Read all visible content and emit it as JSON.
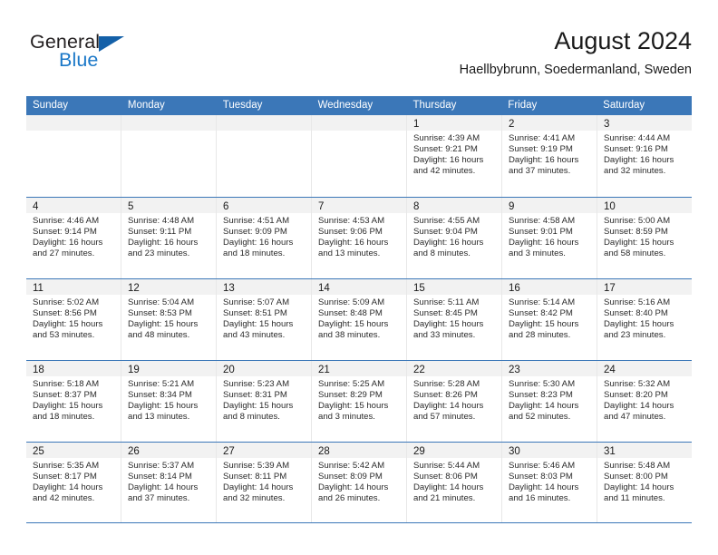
{
  "brand": {
    "name_part1": "General",
    "name_part2": "Blue",
    "triangle_color": "#1460a8",
    "blue_color": "#1b78c8"
  },
  "header": {
    "title": "August 2024",
    "subtitle": "Haellbybrunn, Soedermanland, Sweden"
  },
  "theme": {
    "header_blue": "#3b77b8",
    "date_band_gray": "#f2f2f2",
    "cell_border": "#e8e8e8"
  },
  "weekdays": [
    "Sunday",
    "Monday",
    "Tuesday",
    "Wednesday",
    "Thursday",
    "Friday",
    "Saturday"
  ],
  "weeks": [
    [
      {
        "date": "",
        "empty": true
      },
      {
        "date": "",
        "empty": true
      },
      {
        "date": "",
        "empty": true
      },
      {
        "date": "",
        "empty": true
      },
      {
        "date": "1",
        "sunrise": "Sunrise: 4:39 AM",
        "sunset": "Sunset: 9:21 PM",
        "daylight_line1": "Daylight: 16 hours",
        "daylight_line2": "and 42 minutes."
      },
      {
        "date": "2",
        "sunrise": "Sunrise: 4:41 AM",
        "sunset": "Sunset: 9:19 PM",
        "daylight_line1": "Daylight: 16 hours",
        "daylight_line2": "and 37 minutes."
      },
      {
        "date": "3",
        "sunrise": "Sunrise: 4:44 AM",
        "sunset": "Sunset: 9:16 PM",
        "daylight_line1": "Daylight: 16 hours",
        "daylight_line2": "and 32 minutes."
      }
    ],
    [
      {
        "date": "4",
        "sunrise": "Sunrise: 4:46 AM",
        "sunset": "Sunset: 9:14 PM",
        "daylight_line1": "Daylight: 16 hours",
        "daylight_line2": "and 27 minutes."
      },
      {
        "date": "5",
        "sunrise": "Sunrise: 4:48 AM",
        "sunset": "Sunset: 9:11 PM",
        "daylight_line1": "Daylight: 16 hours",
        "daylight_line2": "and 23 minutes."
      },
      {
        "date": "6",
        "sunrise": "Sunrise: 4:51 AM",
        "sunset": "Sunset: 9:09 PM",
        "daylight_line1": "Daylight: 16 hours",
        "daylight_line2": "and 18 minutes."
      },
      {
        "date": "7",
        "sunrise": "Sunrise: 4:53 AM",
        "sunset": "Sunset: 9:06 PM",
        "daylight_line1": "Daylight: 16 hours",
        "daylight_line2": "and 13 minutes."
      },
      {
        "date": "8",
        "sunrise": "Sunrise: 4:55 AM",
        "sunset": "Sunset: 9:04 PM",
        "daylight_line1": "Daylight: 16 hours",
        "daylight_line2": "and 8 minutes."
      },
      {
        "date": "9",
        "sunrise": "Sunrise: 4:58 AM",
        "sunset": "Sunset: 9:01 PM",
        "daylight_line1": "Daylight: 16 hours",
        "daylight_line2": "and 3 minutes."
      },
      {
        "date": "10",
        "sunrise": "Sunrise: 5:00 AM",
        "sunset": "Sunset: 8:59 PM",
        "daylight_line1": "Daylight: 15 hours",
        "daylight_line2": "and 58 minutes."
      }
    ],
    [
      {
        "date": "11",
        "sunrise": "Sunrise: 5:02 AM",
        "sunset": "Sunset: 8:56 PM",
        "daylight_line1": "Daylight: 15 hours",
        "daylight_line2": "and 53 minutes."
      },
      {
        "date": "12",
        "sunrise": "Sunrise: 5:04 AM",
        "sunset": "Sunset: 8:53 PM",
        "daylight_line1": "Daylight: 15 hours",
        "daylight_line2": "and 48 minutes."
      },
      {
        "date": "13",
        "sunrise": "Sunrise: 5:07 AM",
        "sunset": "Sunset: 8:51 PM",
        "daylight_line1": "Daylight: 15 hours",
        "daylight_line2": "and 43 minutes."
      },
      {
        "date": "14",
        "sunrise": "Sunrise: 5:09 AM",
        "sunset": "Sunset: 8:48 PM",
        "daylight_line1": "Daylight: 15 hours",
        "daylight_line2": "and 38 minutes."
      },
      {
        "date": "15",
        "sunrise": "Sunrise: 5:11 AM",
        "sunset": "Sunset: 8:45 PM",
        "daylight_line1": "Daylight: 15 hours",
        "daylight_line2": "and 33 minutes."
      },
      {
        "date": "16",
        "sunrise": "Sunrise: 5:14 AM",
        "sunset": "Sunset: 8:42 PM",
        "daylight_line1": "Daylight: 15 hours",
        "daylight_line2": "and 28 minutes."
      },
      {
        "date": "17",
        "sunrise": "Sunrise: 5:16 AM",
        "sunset": "Sunset: 8:40 PM",
        "daylight_line1": "Daylight: 15 hours",
        "daylight_line2": "and 23 minutes."
      }
    ],
    [
      {
        "date": "18",
        "sunrise": "Sunrise: 5:18 AM",
        "sunset": "Sunset: 8:37 PM",
        "daylight_line1": "Daylight: 15 hours",
        "daylight_line2": "and 18 minutes."
      },
      {
        "date": "19",
        "sunrise": "Sunrise: 5:21 AM",
        "sunset": "Sunset: 8:34 PM",
        "daylight_line1": "Daylight: 15 hours",
        "daylight_line2": "and 13 minutes."
      },
      {
        "date": "20",
        "sunrise": "Sunrise: 5:23 AM",
        "sunset": "Sunset: 8:31 PM",
        "daylight_line1": "Daylight: 15 hours",
        "daylight_line2": "and 8 minutes."
      },
      {
        "date": "21",
        "sunrise": "Sunrise: 5:25 AM",
        "sunset": "Sunset: 8:29 PM",
        "daylight_line1": "Daylight: 15 hours",
        "daylight_line2": "and 3 minutes."
      },
      {
        "date": "22",
        "sunrise": "Sunrise: 5:28 AM",
        "sunset": "Sunset: 8:26 PM",
        "daylight_line1": "Daylight: 14 hours",
        "daylight_line2": "and 57 minutes."
      },
      {
        "date": "23",
        "sunrise": "Sunrise: 5:30 AM",
        "sunset": "Sunset: 8:23 PM",
        "daylight_line1": "Daylight: 14 hours",
        "daylight_line2": "and 52 minutes."
      },
      {
        "date": "24",
        "sunrise": "Sunrise: 5:32 AM",
        "sunset": "Sunset: 8:20 PM",
        "daylight_line1": "Daylight: 14 hours",
        "daylight_line2": "and 47 minutes."
      }
    ],
    [
      {
        "date": "25",
        "sunrise": "Sunrise: 5:35 AM",
        "sunset": "Sunset: 8:17 PM",
        "daylight_line1": "Daylight: 14 hours",
        "daylight_line2": "and 42 minutes."
      },
      {
        "date": "26",
        "sunrise": "Sunrise: 5:37 AM",
        "sunset": "Sunset: 8:14 PM",
        "daylight_line1": "Daylight: 14 hours",
        "daylight_line2": "and 37 minutes."
      },
      {
        "date": "27",
        "sunrise": "Sunrise: 5:39 AM",
        "sunset": "Sunset: 8:11 PM",
        "daylight_line1": "Daylight: 14 hours",
        "daylight_line2": "and 32 minutes."
      },
      {
        "date": "28",
        "sunrise": "Sunrise: 5:42 AM",
        "sunset": "Sunset: 8:09 PM",
        "daylight_line1": "Daylight: 14 hours",
        "daylight_line2": "and 26 minutes."
      },
      {
        "date": "29",
        "sunrise": "Sunrise: 5:44 AM",
        "sunset": "Sunset: 8:06 PM",
        "daylight_line1": "Daylight: 14 hours",
        "daylight_line2": "and 21 minutes."
      },
      {
        "date": "30",
        "sunrise": "Sunrise: 5:46 AM",
        "sunset": "Sunset: 8:03 PM",
        "daylight_line1": "Daylight: 14 hours",
        "daylight_line2": "and 16 minutes."
      },
      {
        "date": "31",
        "sunrise": "Sunrise: 5:48 AM",
        "sunset": "Sunset: 8:00 PM",
        "daylight_line1": "Daylight: 14 hours",
        "daylight_line2": "and 11 minutes."
      }
    ]
  ]
}
